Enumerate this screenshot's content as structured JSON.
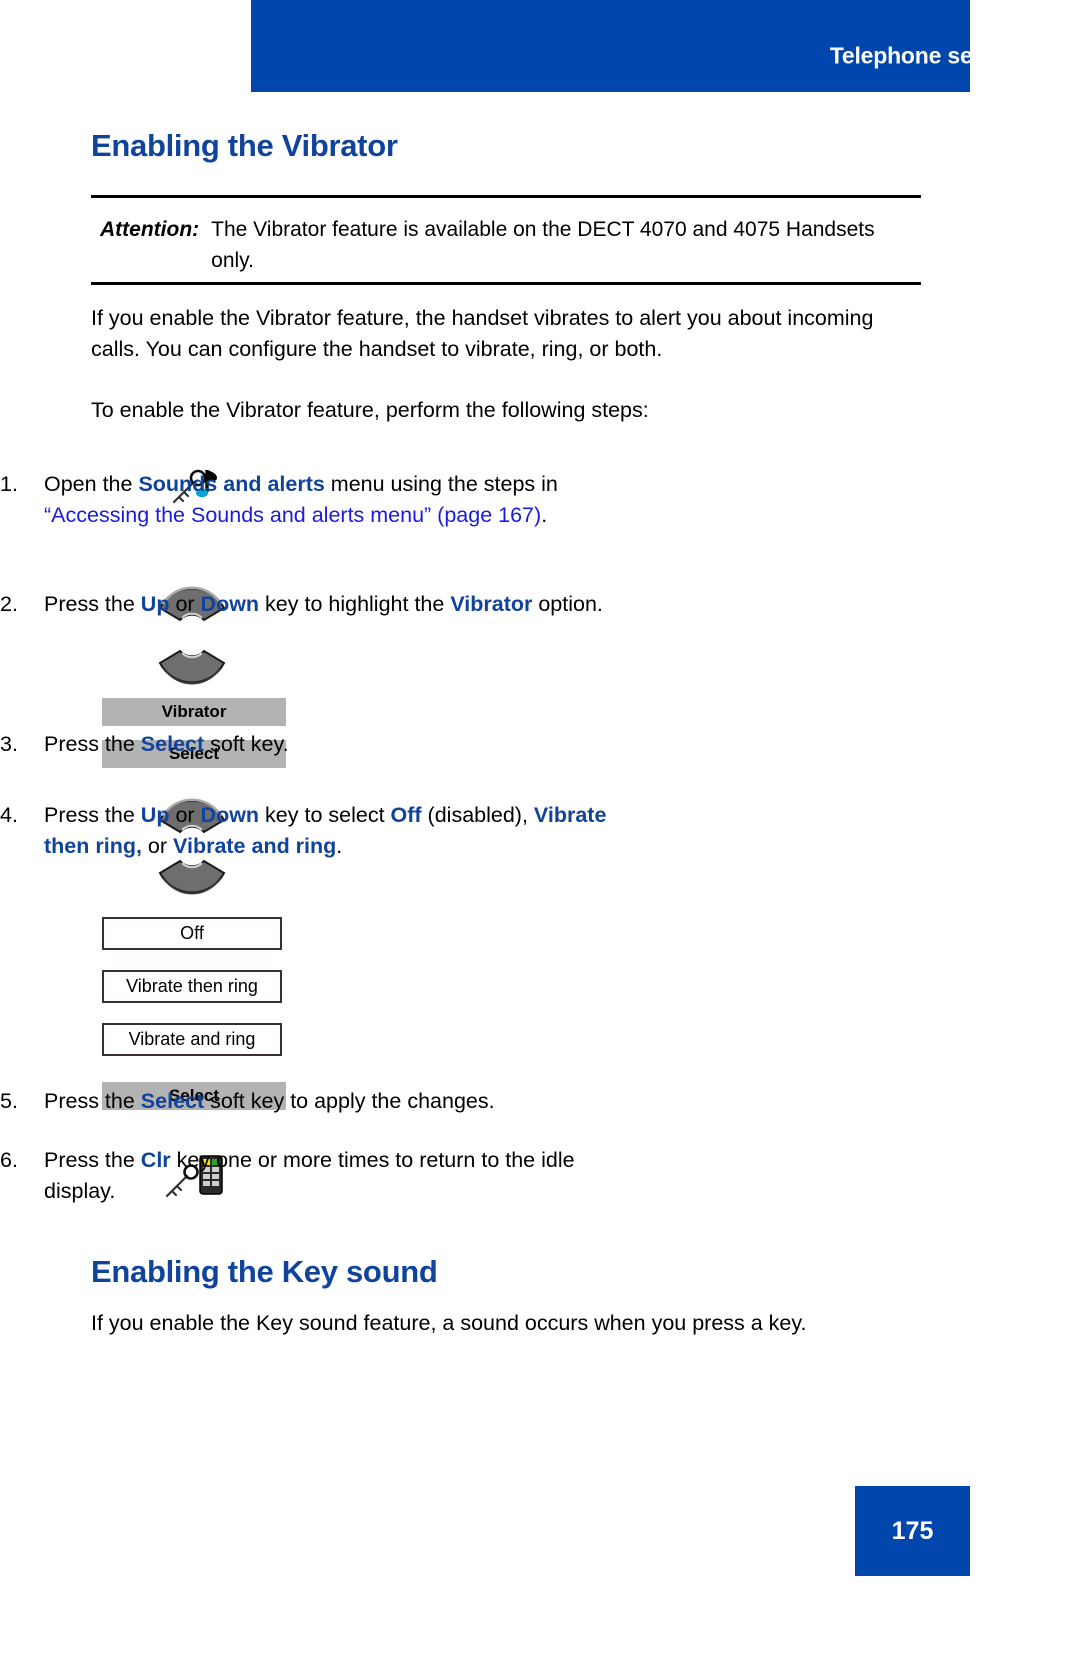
{
  "header": {
    "title": "Telephone settings"
  },
  "sections": {
    "vibrator": {
      "heading": "Enabling the Vibrator",
      "attention_label": "Attention:",
      "attention_text": "The Vibrator feature is available on the DECT 4070 and 4075 Handsets only.",
      "para_1": "If you enable the Vibrator feature, the handset vibrates to alert you about incoming calls. You can configure the handset to vibrate, ring, or both.",
      "para_2": "To enable the Vibrator feature, perform the following steps:"
    },
    "keysound": {
      "heading": "Enabling the Key sound",
      "para_1": "If you enable the Key sound feature, a sound occurs when you press a key."
    }
  },
  "steps": [
    {
      "num": "1.",
      "t1": "Open the ",
      "b1": "Sounds and alerts",
      "t2": " menu using the steps in ",
      "link": "“Accessing the Sounds and alerts menu” (page 167)",
      "t3": ".",
      "icon": "sounds-and-alerts-key-icon"
    },
    {
      "num": "2.",
      "t1": "Press the ",
      "b1": "Up",
      "t2": " or ",
      "b2": "Down",
      "t3": " key to highlight the ",
      "b3": "Vibrator",
      "t4": " option."
    },
    {
      "num": "3.",
      "t1": "Press the ",
      "b1": "Select",
      "t2": " soft key."
    },
    {
      "num": "4.",
      "t1": "Press the ",
      "b1": "Up",
      "t2": " or ",
      "b2": "Down",
      "t3": " key to select ",
      "b3": "Off",
      "t4": " (disabled), ",
      "b4": "Vibrate then ring,",
      "t5": " or ",
      "b5": "Vibrate and ring",
      "t6": "."
    },
    {
      "num": "5.",
      "t1": "Press the ",
      "b1": "Select",
      "t2": " soft key to apply the changes."
    },
    {
      "num": "6.",
      "t1": "Press the ",
      "b1": "Clr",
      "t2": " key one or more times to return to the idle display.",
      "icon": "clr-key-icon"
    }
  ],
  "graphics": {
    "softkey_vibrator": "Vibrator",
    "softkey_select_step3": "Select",
    "softkey_select_step5": "Select",
    "option_off": "Off",
    "option_vibrate_then_ring": "Vibrate then ring",
    "option_vibrate_and_ring": "Vibrate and ring",
    "navkey_up": "up-navigation-key",
    "navkey_down": "down-navigation-key"
  },
  "footer": {
    "page_number": "175"
  },
  "colors": {
    "brand_blue": "#0046ad",
    "heading_blue": "#10439b",
    "link_blue": "#1a1ae0",
    "softkey_gray": "#b3b3b3"
  }
}
